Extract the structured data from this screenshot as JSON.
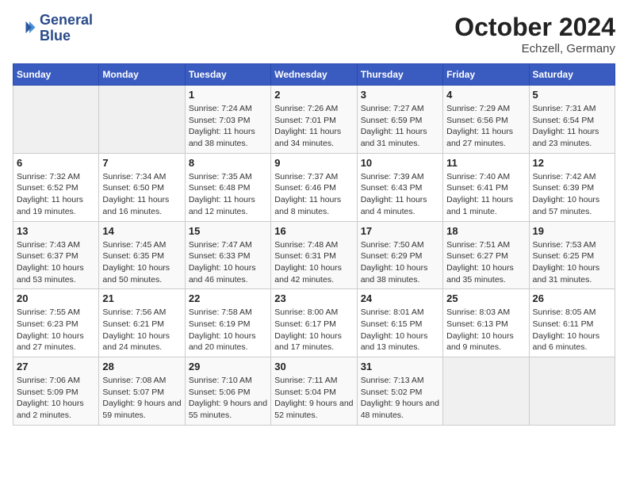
{
  "header": {
    "logo_line1": "General",
    "logo_line2": "Blue",
    "month": "October 2024",
    "location": "Echzell, Germany"
  },
  "weekdays": [
    "Sunday",
    "Monday",
    "Tuesday",
    "Wednesday",
    "Thursday",
    "Friday",
    "Saturday"
  ],
  "weeks": [
    [
      {
        "day": "",
        "detail": ""
      },
      {
        "day": "",
        "detail": ""
      },
      {
        "day": "1",
        "detail": "Sunrise: 7:24 AM\nSunset: 7:03 PM\nDaylight: 11 hours and 38 minutes."
      },
      {
        "day": "2",
        "detail": "Sunrise: 7:26 AM\nSunset: 7:01 PM\nDaylight: 11 hours and 34 minutes."
      },
      {
        "day": "3",
        "detail": "Sunrise: 7:27 AM\nSunset: 6:59 PM\nDaylight: 11 hours and 31 minutes."
      },
      {
        "day": "4",
        "detail": "Sunrise: 7:29 AM\nSunset: 6:56 PM\nDaylight: 11 hours and 27 minutes."
      },
      {
        "day": "5",
        "detail": "Sunrise: 7:31 AM\nSunset: 6:54 PM\nDaylight: 11 hours and 23 minutes."
      }
    ],
    [
      {
        "day": "6",
        "detail": "Sunrise: 7:32 AM\nSunset: 6:52 PM\nDaylight: 11 hours and 19 minutes."
      },
      {
        "day": "7",
        "detail": "Sunrise: 7:34 AM\nSunset: 6:50 PM\nDaylight: 11 hours and 16 minutes."
      },
      {
        "day": "8",
        "detail": "Sunrise: 7:35 AM\nSunset: 6:48 PM\nDaylight: 11 hours and 12 minutes."
      },
      {
        "day": "9",
        "detail": "Sunrise: 7:37 AM\nSunset: 6:46 PM\nDaylight: 11 hours and 8 minutes."
      },
      {
        "day": "10",
        "detail": "Sunrise: 7:39 AM\nSunset: 6:43 PM\nDaylight: 11 hours and 4 minutes."
      },
      {
        "day": "11",
        "detail": "Sunrise: 7:40 AM\nSunset: 6:41 PM\nDaylight: 11 hours and 1 minute."
      },
      {
        "day": "12",
        "detail": "Sunrise: 7:42 AM\nSunset: 6:39 PM\nDaylight: 10 hours and 57 minutes."
      }
    ],
    [
      {
        "day": "13",
        "detail": "Sunrise: 7:43 AM\nSunset: 6:37 PM\nDaylight: 10 hours and 53 minutes."
      },
      {
        "day": "14",
        "detail": "Sunrise: 7:45 AM\nSunset: 6:35 PM\nDaylight: 10 hours and 50 minutes."
      },
      {
        "day": "15",
        "detail": "Sunrise: 7:47 AM\nSunset: 6:33 PM\nDaylight: 10 hours and 46 minutes."
      },
      {
        "day": "16",
        "detail": "Sunrise: 7:48 AM\nSunset: 6:31 PM\nDaylight: 10 hours and 42 minutes."
      },
      {
        "day": "17",
        "detail": "Sunrise: 7:50 AM\nSunset: 6:29 PM\nDaylight: 10 hours and 38 minutes."
      },
      {
        "day": "18",
        "detail": "Sunrise: 7:51 AM\nSunset: 6:27 PM\nDaylight: 10 hours and 35 minutes."
      },
      {
        "day": "19",
        "detail": "Sunrise: 7:53 AM\nSunset: 6:25 PM\nDaylight: 10 hours and 31 minutes."
      }
    ],
    [
      {
        "day": "20",
        "detail": "Sunrise: 7:55 AM\nSunset: 6:23 PM\nDaylight: 10 hours and 27 minutes."
      },
      {
        "day": "21",
        "detail": "Sunrise: 7:56 AM\nSunset: 6:21 PM\nDaylight: 10 hours and 24 minutes."
      },
      {
        "day": "22",
        "detail": "Sunrise: 7:58 AM\nSunset: 6:19 PM\nDaylight: 10 hours and 20 minutes."
      },
      {
        "day": "23",
        "detail": "Sunrise: 8:00 AM\nSunset: 6:17 PM\nDaylight: 10 hours and 17 minutes."
      },
      {
        "day": "24",
        "detail": "Sunrise: 8:01 AM\nSunset: 6:15 PM\nDaylight: 10 hours and 13 minutes."
      },
      {
        "day": "25",
        "detail": "Sunrise: 8:03 AM\nSunset: 6:13 PM\nDaylight: 10 hours and 9 minutes."
      },
      {
        "day": "26",
        "detail": "Sunrise: 8:05 AM\nSunset: 6:11 PM\nDaylight: 10 hours and 6 minutes."
      }
    ],
    [
      {
        "day": "27",
        "detail": "Sunrise: 7:06 AM\nSunset: 5:09 PM\nDaylight: 10 hours and 2 minutes."
      },
      {
        "day": "28",
        "detail": "Sunrise: 7:08 AM\nSunset: 5:07 PM\nDaylight: 9 hours and 59 minutes."
      },
      {
        "day": "29",
        "detail": "Sunrise: 7:10 AM\nSunset: 5:06 PM\nDaylight: 9 hours and 55 minutes."
      },
      {
        "day": "30",
        "detail": "Sunrise: 7:11 AM\nSunset: 5:04 PM\nDaylight: 9 hours and 52 minutes."
      },
      {
        "day": "31",
        "detail": "Sunrise: 7:13 AM\nSunset: 5:02 PM\nDaylight: 9 hours and 48 minutes."
      },
      {
        "day": "",
        "detail": ""
      },
      {
        "day": "",
        "detail": ""
      }
    ]
  ]
}
